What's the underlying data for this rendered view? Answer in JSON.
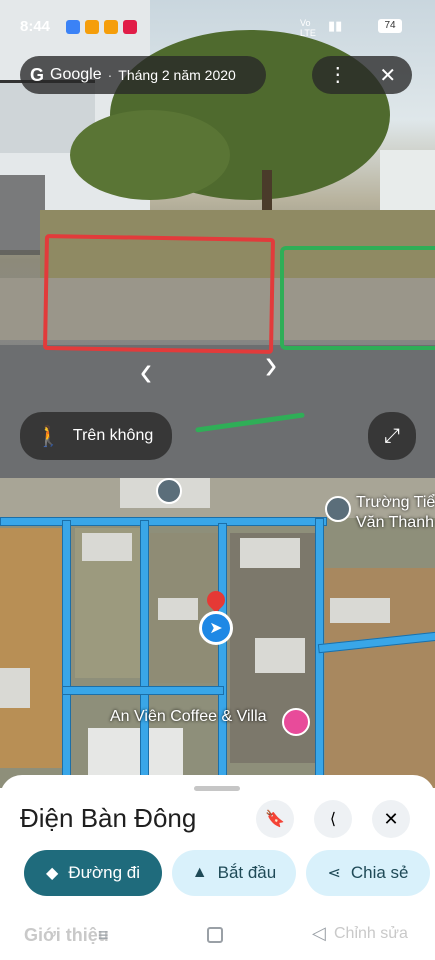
{
  "status_bar": {
    "time": "8:44",
    "network": "Vo LTE",
    "battery": "74"
  },
  "streetview": {
    "source": "Google",
    "date": "Tháng 2 năm 2020",
    "mode_label": "Trên không"
  },
  "map": {
    "place_1": "Trường Tiể",
    "place_1b": "Văn Thanh",
    "place_2": "An Viên Coffee & Villa"
  },
  "sheet": {
    "title": "Điện Bàn Đông",
    "directions_label": "Đường đi",
    "start_label": "Bắt đầu",
    "share_label": "Chia sẻ",
    "intro_label": "Giới thiệu",
    "edit_label": "Chỉnh sửa"
  },
  "colors": {
    "accent": "#1f6b7c",
    "chip_bg": "#d9f1fb",
    "road": "#39a6e8"
  }
}
